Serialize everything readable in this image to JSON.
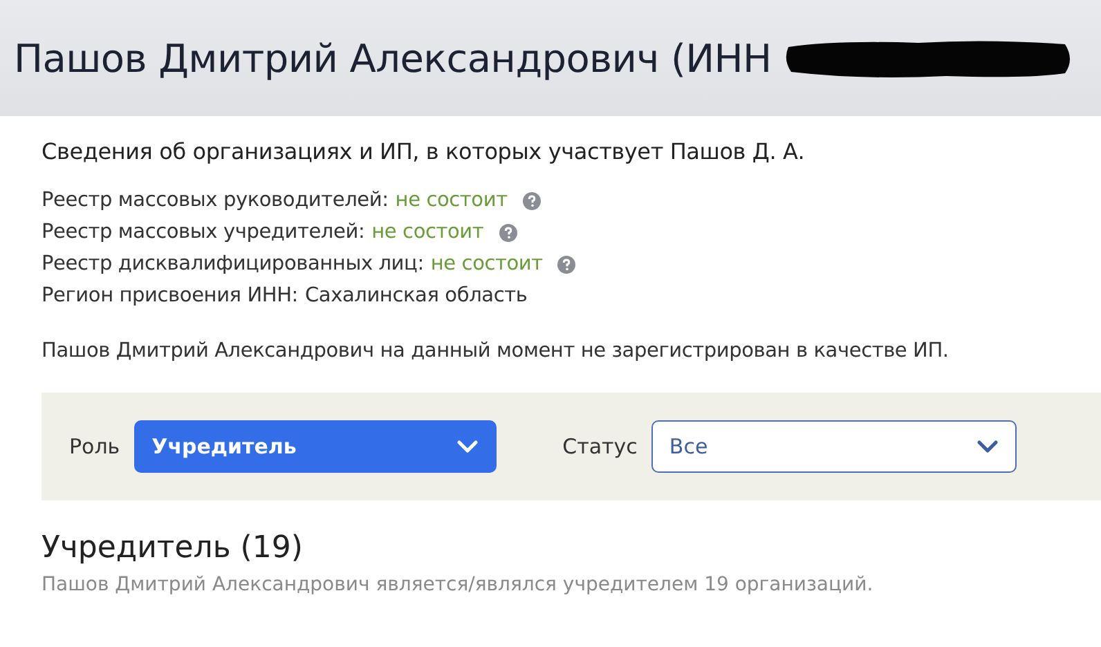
{
  "header": {
    "title": "Пашов Дмитрий Александрович (ИНН",
    "redacted": true
  },
  "intro": "Сведения об организациях и ИП, в которых участвует Пашов Д. А.",
  "registries": [
    {
      "label": "Реестр массовых руководителей:",
      "value": "не состоит",
      "kind": "status",
      "help": true
    },
    {
      "label": "Реестр массовых учредителей:",
      "value": "не состоит",
      "kind": "status",
      "help": true
    },
    {
      "label": "Реестр дисквалифицированных лиц:",
      "value": "не состоит",
      "kind": "status",
      "help": true
    },
    {
      "label": "Регион присвоения ИНН:",
      "value": "Сахалинская область",
      "kind": "info",
      "help": false
    }
  ],
  "ip_note": "Пашов Дмитрий Александрович на данный момент не зарегистрирован в качестве ИП.",
  "filters": [
    {
      "label": "Роль",
      "value": "Учредитель",
      "active": true
    },
    {
      "label": "Статус",
      "value": "Все",
      "active": false
    }
  ],
  "section": {
    "title": "Учредитель (19)",
    "subtitle": "Пашов Дмитрий Александрович является/являлся учредителем 19 организаций."
  }
}
